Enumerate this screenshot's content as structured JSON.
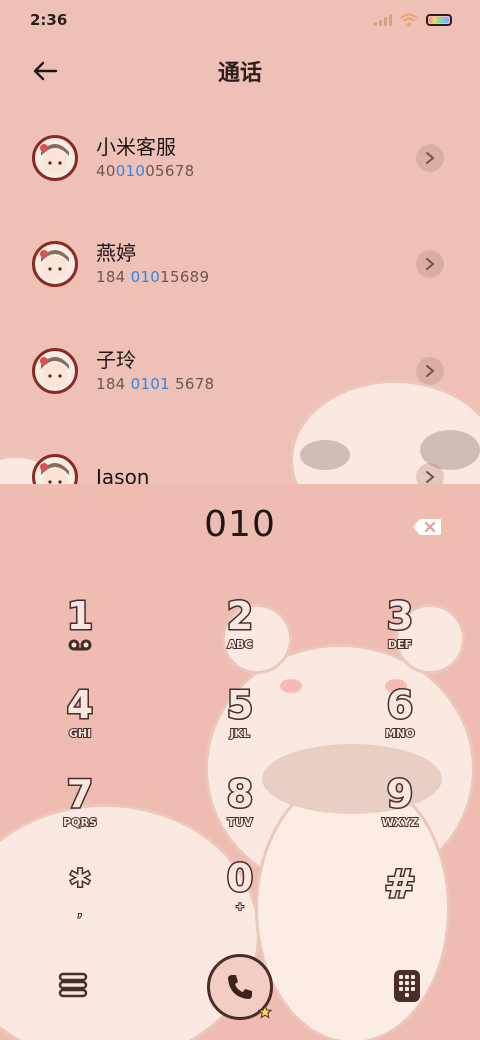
{
  "status": {
    "time": "2:36"
  },
  "header": {
    "title": "通话"
  },
  "contacts": [
    {
      "name": "小米客服",
      "number_pre": "40",
      "number_hl": "010",
      "number_post": "05678"
    },
    {
      "name": "燕婷",
      "number_pre": "184 ",
      "number_hl": "010",
      "number_post": "15689"
    },
    {
      "name": "子玲",
      "number_pre": "184 ",
      "number_hl": "0101",
      "number_post": " 5678"
    },
    {
      "name": "Jason",
      "number_pre": "",
      "number_hl": "",
      "number_post": ""
    }
  ],
  "dialer": {
    "input": "010",
    "keys": [
      {
        "digit": "1",
        "letters": ""
      },
      {
        "digit": "2",
        "letters": "ABC"
      },
      {
        "digit": "3",
        "letters": "DEF"
      },
      {
        "digit": "4",
        "letters": "GHI"
      },
      {
        "digit": "5",
        "letters": "JKL"
      },
      {
        "digit": "6",
        "letters": "MNO"
      },
      {
        "digit": "7",
        "letters": "PQRS"
      },
      {
        "digit": "8",
        "letters": "TUV"
      },
      {
        "digit": "9",
        "letters": "WXYZ"
      },
      {
        "digit": "*",
        "letters": ","
      },
      {
        "digit": "0",
        "letters": "+"
      },
      {
        "digit": "#",
        "letters": ""
      }
    ]
  },
  "icons": {
    "back": "arrow-left-icon",
    "delete": "backspace-icon",
    "menu": "menu-icon",
    "call": "phone-icon",
    "keypad": "keypad-icon",
    "voicemail": "voicemail-icon"
  },
  "colors": {
    "background": "#efc1b6",
    "highlight": "#2f86e6",
    "key_outline": "#4a2d28"
  }
}
